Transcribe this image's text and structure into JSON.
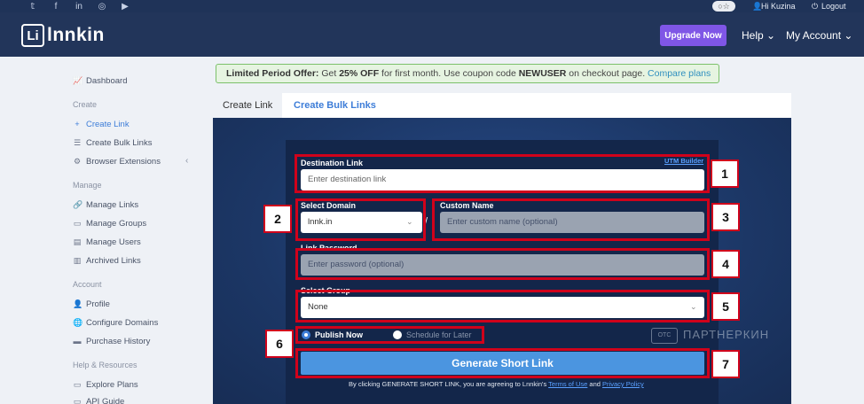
{
  "topbar": {
    "social": [
      "twitter-icon",
      "facebook-icon",
      "linkedin-icon",
      "instagram-icon",
      "youtube-icon"
    ],
    "social_glyphs": [
      "𝕥",
      "f",
      "in",
      "◎",
      "▶"
    ],
    "user_greeting": "Hi Kuzina",
    "logout_label": "Logout"
  },
  "header": {
    "brand_mark": "Li",
    "brand_name": "lnnkin",
    "upgrade_label": "Upgrade Now",
    "help_label": "Help",
    "account_label": "My Account"
  },
  "sidebar": {
    "dashboard": "Dashboard",
    "create_head": "Create",
    "create_link": "Create Link",
    "create_bulk": "Create Bulk Links",
    "browser_ext": "Browser Extensions",
    "manage_head": "Manage",
    "manage_links": "Manage Links",
    "manage_groups": "Manage Groups",
    "manage_users": "Manage Users",
    "archived_links": "Archived Links",
    "account_head": "Account",
    "profile": "Profile",
    "configure_domains": "Configure Domains",
    "purchase_history": "Purchase History",
    "help_head": "Help & Resources",
    "explore_plans": "Explore Plans",
    "api_guide": "API Guide"
  },
  "offer": {
    "lead": "Limited Period Offer:",
    "text1": " Get ",
    "discount": "25% OFF",
    "text2": " for first month. Use coupon code ",
    "coupon": "NEWUSER",
    "text3": " on checkout page. ",
    "link": "Compare plans"
  },
  "tabs": {
    "create_link": "Create Link",
    "create_bulk": "Create Bulk Links"
  },
  "form": {
    "destination_label": "Destination Link",
    "utm_builder": "UTM Builder",
    "destination_placeholder": "Enter destination link",
    "domain_label": "Select Domain",
    "domain_value": "lnnk.in",
    "via_symbol": "/",
    "custom_name_label": "Custom Name",
    "custom_name_placeholder": "Enter custom name (optional)",
    "password_label": "Link Password",
    "password_placeholder": "Enter password (optional)",
    "group_label": "Select Group",
    "group_value": "None",
    "publish_now": "Publish Now",
    "schedule_later": "Schedule for Later",
    "generate_label": "Generate Short Link",
    "terms_text": "By clicking GENERATE SHORT LINK, you are agreeing to Lnnkin's ",
    "terms_link": "Terms of Use",
    "terms_and": " and ",
    "privacy_link": "Privacy Policy"
  },
  "annotations": [
    "1",
    "2",
    "3",
    "4",
    "5",
    "6",
    "7"
  ],
  "watermark": {
    "box": "ОТС",
    "text": "ПАРТНЕРКИН"
  },
  "colors": {
    "header": "#22355a",
    "accent": "#7f56e6",
    "button": "#4b95e0",
    "annotation": "#d0021b"
  }
}
